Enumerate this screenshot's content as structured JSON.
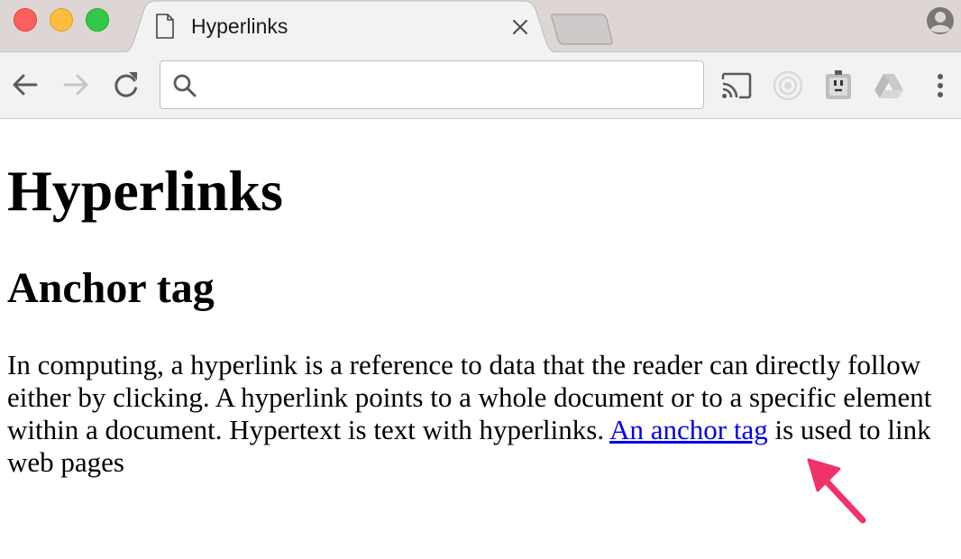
{
  "window": {
    "traffic_lights": [
      "close",
      "minimize",
      "maximize"
    ]
  },
  "tab": {
    "title": "Hyperlinks",
    "icon": "document-icon",
    "close_icon": "close-icon"
  },
  "toolbar": {
    "back_icon": "back-arrow-icon",
    "forward_icon": "forward-arrow-icon",
    "reload_icon": "reload-icon",
    "omnibox": {
      "value": "",
      "placeholder": "",
      "icon": "search-icon"
    },
    "extensions": [
      "cast-icon",
      "circle-extension-icon",
      "plug-extension-icon",
      "drive-icon",
      "menu-icon"
    ]
  },
  "page": {
    "heading": "Hyperlinks",
    "subheading": "Anchor tag",
    "paragraph_before": "In computing, a hyperlink is a reference to data that the reader can directly follow either by clicking. A hyperlink points to a whole document or to a specific element within a document. Hypertext is text with hyperlinks. ",
    "link_text": "An anchor tag",
    "paragraph_after": " is used to link web pages"
  },
  "colors": {
    "link": "#0000ee",
    "annotation_arrow": "#f0326a",
    "tabstrip": "#ddd6d4",
    "toolbar": "#f2f2f2"
  }
}
